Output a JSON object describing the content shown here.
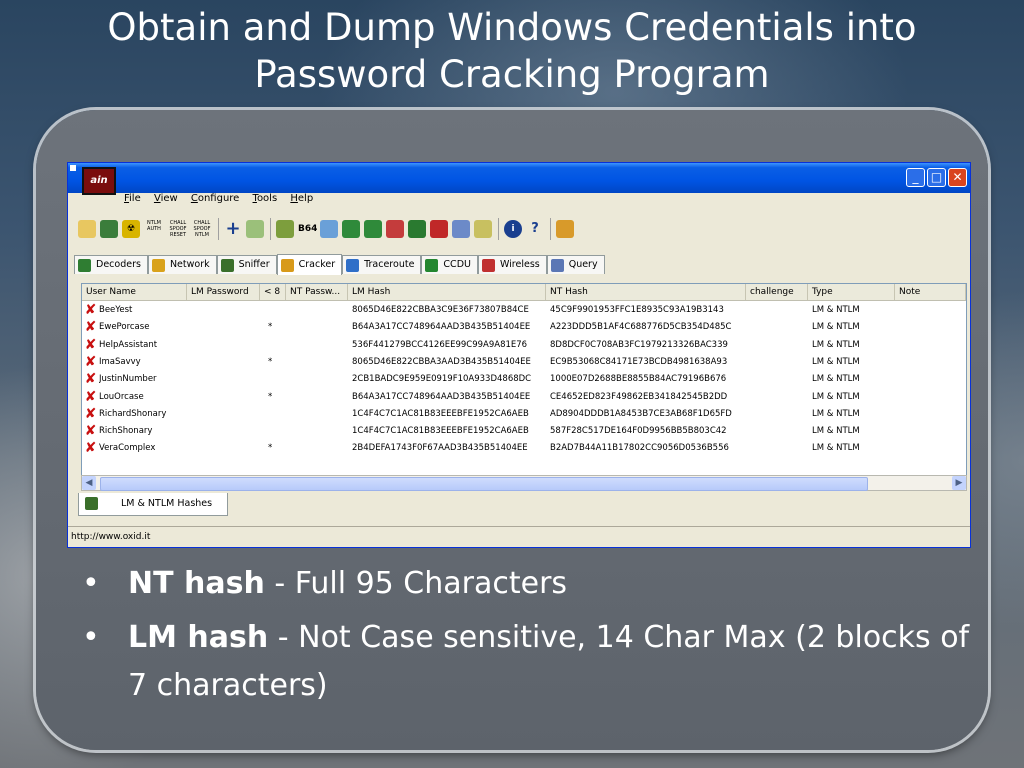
{
  "slide": {
    "title_line1": "Obtain and Dump  Windows Credentials into",
    "title_line2": "Password Cracking Program"
  },
  "window": {
    "app_logo": "ain",
    "menu": [
      "File",
      "View",
      "Configure",
      "Tools",
      "Help"
    ],
    "toolbar_icons": [
      "open-folder-icon",
      "network-icon",
      "radiation-icon",
      "ntlm-auth-icon",
      "challenge-spoof-reset-icon",
      "challenge-spoof-ntlm-icon",
      "add-icon",
      "certificate-icon",
      "sniffer-toggle-icon",
      "base64-icon",
      "decoder-icon",
      "lsa-secrets-icon",
      "vnc-icon",
      "rdp-icon",
      "terminal-icon",
      "routing-icon",
      "hash-calc-icon",
      "wireless-icon",
      "info-icon",
      "help-icon",
      "tower-icon"
    ],
    "toolbar_labels": {
      "ntlm_auth": "NTLM AUTH",
      "spoof_reset": "CHALL SPOOF RESET",
      "spoof_ntlm": "CHALL SPOOF NTLM",
      "base64": "B64"
    },
    "tabs": [
      {
        "label": "Decoders",
        "icon": "decoders-icon",
        "color": "#2f7d32"
      },
      {
        "label": "Network",
        "icon": "network-icon",
        "color": "#d9a21b"
      },
      {
        "label": "Sniffer",
        "icon": "sniffer-icon",
        "color": "#3a6f2a"
      },
      {
        "label": "Cracker",
        "icon": "cracker-icon",
        "color": "#d89a1a"
      },
      {
        "label": "Traceroute",
        "icon": "traceroute-icon",
        "color": "#2f6fc8"
      },
      {
        "label": "CCDU",
        "icon": "ccdu-icon",
        "color": "#23862f"
      },
      {
        "label": "Wireless",
        "icon": "wireless-icon",
        "color": "#c03030"
      },
      {
        "label": "Query",
        "icon": "query-icon",
        "color": "#5b77b5"
      }
    ],
    "active_tab": "Cracker",
    "columns": [
      "User Name",
      "LM Password",
      "< 8",
      "NT Passw...",
      "LM Hash",
      "NT Hash",
      "challenge",
      "Type",
      "Note"
    ],
    "rows": [
      {
        "user": "BeeYest",
        "lm_pass": "",
        "lt8": "",
        "nt_pass": "",
        "lm_hash": "8065D46E822CBBA3C9E36F73807B84CE",
        "nt_hash": "45C9F9901953FFC1E8935C93A19B3143",
        "challenge": "",
        "type": "LM & NTLM",
        "note": ""
      },
      {
        "user": "EwePorcase",
        "lm_pass": "",
        "lt8": "*",
        "nt_pass": "",
        "lm_hash": "B64A3A17CC748964AAD3B435B51404EE",
        "nt_hash": "A223DDD5B1AF4C688776D5CB354D485C",
        "challenge": "",
        "type": "LM & NTLM",
        "note": ""
      },
      {
        "user": "HelpAssistant",
        "lm_pass": "",
        "lt8": "",
        "nt_pass": "",
        "lm_hash": "536F441279BCC4126EE99C99A9A81E76",
        "nt_hash": "8D8DCF0C708AB3FC1979213326BAC339",
        "challenge": "",
        "type": "LM & NTLM",
        "note": ""
      },
      {
        "user": "ImaSavvy",
        "lm_pass": "",
        "lt8": "*",
        "nt_pass": "",
        "lm_hash": "8065D46E822CBBA3AAD3B435B51404EE",
        "nt_hash": "EC9B53068C84171E73BCDB4981638A93",
        "challenge": "",
        "type": "LM & NTLM",
        "note": ""
      },
      {
        "user": "JustinNumber",
        "lm_pass": "",
        "lt8": "",
        "nt_pass": "",
        "lm_hash": "2CB1BADC9E959E0919F10A933D4868DC",
        "nt_hash": "1000E07D2688BE8855B84AC79196B676",
        "challenge": "",
        "type": "LM & NTLM",
        "note": ""
      },
      {
        "user": "LouOrcase",
        "lm_pass": "",
        "lt8": "*",
        "nt_pass": "",
        "lm_hash": "B64A3A17CC748964AAD3B435B51404EE",
        "nt_hash": "CE4652ED823F49862EB341842545B2DD",
        "challenge": "",
        "type": "LM & NTLM",
        "note": ""
      },
      {
        "user": "RichardShonary",
        "lm_pass": "",
        "lt8": "",
        "nt_pass": "",
        "lm_hash": "1C4F4C7C1AC81B83EEEBFE1952CA6AEB",
        "nt_hash": "AD8904DDDB1A8453B7CE3AB68F1D65FD",
        "challenge": "",
        "type": "LM & NTLM",
        "note": ""
      },
      {
        "user": "RichShonary",
        "lm_pass": "",
        "lt8": "",
        "nt_pass": "",
        "lm_hash": "1C4F4C7C1AC81B83EEEBFE1952CA6AEB",
        "nt_hash": "587F28C517DE164F0D9956BB5B803C42",
        "challenge": "",
        "type": "LM & NTLM",
        "note": ""
      },
      {
        "user": "VeraComplex",
        "lm_pass": "",
        "lt8": "*",
        "nt_pass": "",
        "lm_hash": "2B4DEFA1743F0F67AAD3B435B51404EE",
        "nt_hash": "B2AD7B44A11B17802CC9056D0536B556",
        "challenge": "",
        "type": "LM & NTLM",
        "note": ""
      }
    ],
    "bottom_tab": "LM & NTLM Hashes",
    "status": "http://www.oxid.it"
  },
  "bullets": [
    {
      "bold": "NT hash",
      "text": " - Full 95 Characters"
    },
    {
      "bold": "LM hash",
      "text": " -  Not Case sensitive, 14 Char Max (2 blocks of 7 characters)"
    }
  ]
}
